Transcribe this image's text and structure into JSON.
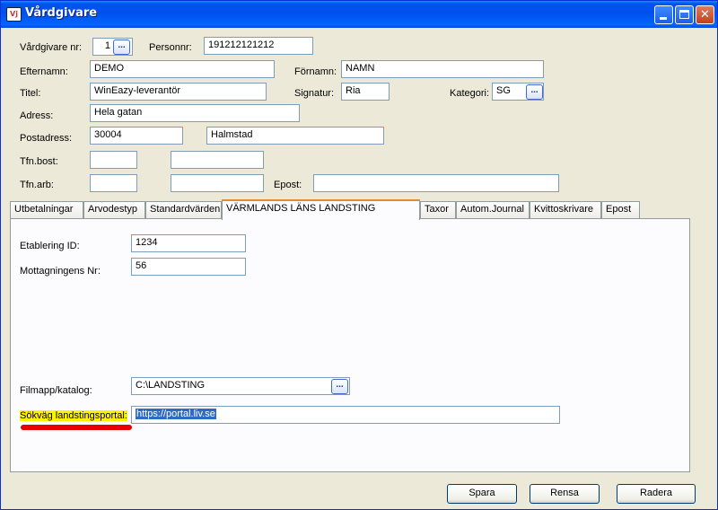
{
  "window": {
    "title": "Vårdgivare",
    "icon_text": "Vj"
  },
  "form": {
    "vardgivare_nr_label": "Vårdgivare nr:",
    "vardgivare_nr_value": "1",
    "personnr_label": "Personnr:",
    "personnr_value": "191212121212",
    "efternamn_label": "Efternamn:",
    "efternamn_value": "DEMO",
    "fornamn_label": "Förnamn:",
    "fornamn_value": "NAMN",
    "titel_label": "Titel:",
    "titel_value": "WinEazy-leverantör",
    "signatur_label": "Signatur:",
    "signatur_value": "Ria",
    "kategori_label": "Kategori:",
    "kategori_value": "SG",
    "adress_label": "Adress:",
    "adress_value": "Hela gatan",
    "postadress_label": "Postadress:",
    "postnr_value": "30004",
    "ort_value": "Halmstad",
    "tfn_bost_label": "Tfn.bost:",
    "tfn_arb_label": "Tfn.arb:",
    "epost_label": "Epost:"
  },
  "tabs": [
    {
      "label": "Utbetalningar"
    },
    {
      "label": "Arvodestyp"
    },
    {
      "label": "Standardvärden"
    },
    {
      "label": "VÄRMLANDS LÄNS LANDSTING"
    },
    {
      "label": "Taxor"
    },
    {
      "label": "Autom.Journal"
    },
    {
      "label": "Kvittoskrivare"
    },
    {
      "label": "Epost"
    }
  ],
  "panel": {
    "etablering_label": "Etablering ID:",
    "etablering_value": "1234",
    "mottagning_label": "Mottagningens Nr:",
    "mottagning_value": "56",
    "filmapp_label": "Filmapp/katalog:",
    "filmapp_value": "C:\\LANDSTING",
    "sokvag_label": "Sökväg landstingsportal:",
    "sokvag_value": "https://portal.liv.se"
  },
  "buttons": {
    "spara": "Spara",
    "rensa": "Rensa",
    "radera": "Radera"
  },
  "icons": {
    "dots_glyph": "..."
  }
}
